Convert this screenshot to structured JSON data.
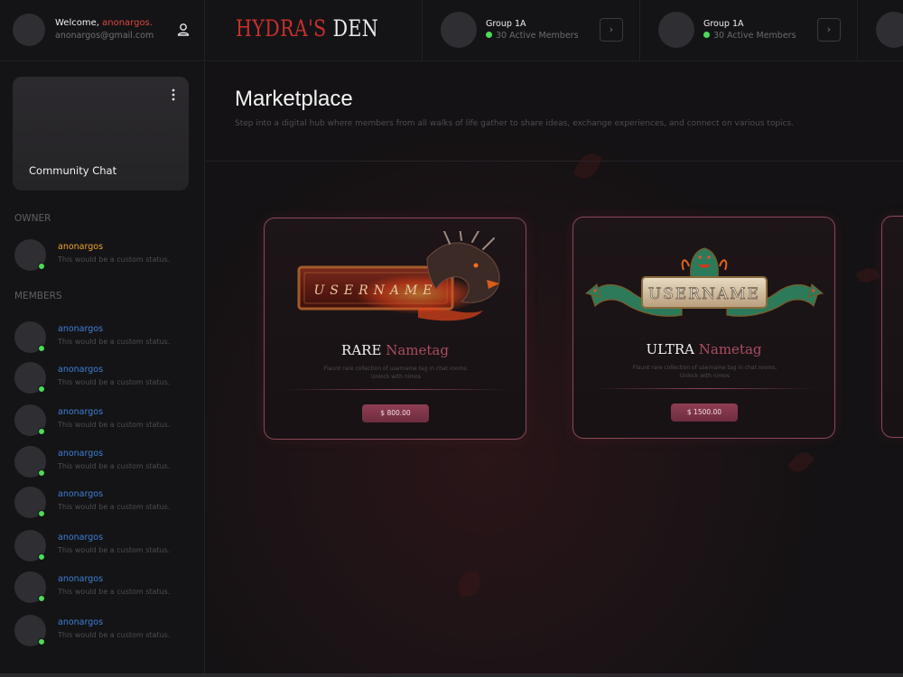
{
  "user": {
    "welcome_prefix": "Welcome, ",
    "name": "anonargos.",
    "email": "anonargos@gmail.com",
    "profile_icon": "user-icon"
  },
  "logo": {
    "part1": "HYDRA'S",
    "part2": " DEN"
  },
  "groups": [
    {
      "name": "Group 1A",
      "status": "30 Active Members",
      "button": "›"
    },
    {
      "name": "Group 1A",
      "status": "30 Active Members",
      "button": "›"
    }
  ],
  "sidebar": {
    "chat_card": {
      "title": "Community Chat",
      "menu_icon": "more-vertical-icon"
    },
    "owner_label": "OWNER",
    "owner": {
      "name": "anonargos",
      "status": "This would be a custom status.",
      "color": "#f0a32a"
    },
    "members_label": "MEMBERS",
    "members": [
      {
        "name": "anonargos",
        "status": "This would be a custom status."
      },
      {
        "name": "anonargos",
        "status": "This would be a custom status."
      },
      {
        "name": "anonargos",
        "status": "This would be a custom status."
      },
      {
        "name": "anonargos",
        "status": "This would be a custom status."
      },
      {
        "name": "anonargos",
        "status": "This would be a custom status."
      },
      {
        "name": "anonargos",
        "status": "This would be a custom status."
      },
      {
        "name": "anonargos",
        "status": "This would be a custom status."
      },
      {
        "name": "anonargos",
        "status": "This would be a custom status."
      }
    ],
    "member_color": "#3f7fd9"
  },
  "main": {
    "title": "Marketplace",
    "subtitle": "Step into a digital hub where members from all walks of life gather to share ideas, exchange experiences, and connect on various topics.",
    "cards": [
      {
        "tier": "RARE",
        "item": "Nametag",
        "art_text": "USERNAME",
        "description_1": "Flaunt rare collection of username tag in chat rooms.",
        "description_2": "Unlock with nimos",
        "price": "$ 800.00"
      },
      {
        "tier": "ULTRA",
        "item": "Nametag",
        "art_text": "USERNAME",
        "description_1": "Flaunt rare collection of username tag in chat rooms.",
        "description_2": "Unlock with nimos",
        "price": "$ 1500.00"
      }
    ]
  },
  "colors": {
    "accent_red": "#c7302c",
    "online_green": "#4cdc58",
    "card_border": "#8a4858"
  }
}
